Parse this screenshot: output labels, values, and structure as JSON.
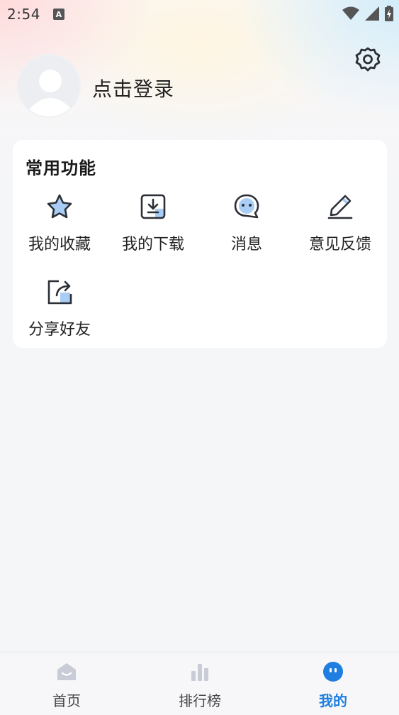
{
  "status_bar": {
    "time": "2:54",
    "notification_letter": "A"
  },
  "profile": {
    "login_prompt": "点击登录"
  },
  "common_functions": {
    "title": "常用功能",
    "items": [
      {
        "label": "我的收藏",
        "icon": "star-icon"
      },
      {
        "label": "我的下载",
        "icon": "download-icon"
      },
      {
        "label": "消息",
        "icon": "message-icon"
      },
      {
        "label": "意见反馈",
        "icon": "feedback-pen-icon"
      },
      {
        "label": "分享好友",
        "icon": "share-icon"
      }
    ]
  },
  "tabbar": {
    "tabs": [
      {
        "label": "首页",
        "icon": "home-icon",
        "active": false
      },
      {
        "label": "排行榜",
        "icon": "ranking-icon",
        "active": false
      },
      {
        "label": "我的",
        "icon": "profile-face-icon",
        "active": true
      }
    ]
  },
  "colors": {
    "accent": "#1f7fe0",
    "icon_light_blue": "#a9cdf5",
    "icon_stroke": "#2b2f36"
  }
}
